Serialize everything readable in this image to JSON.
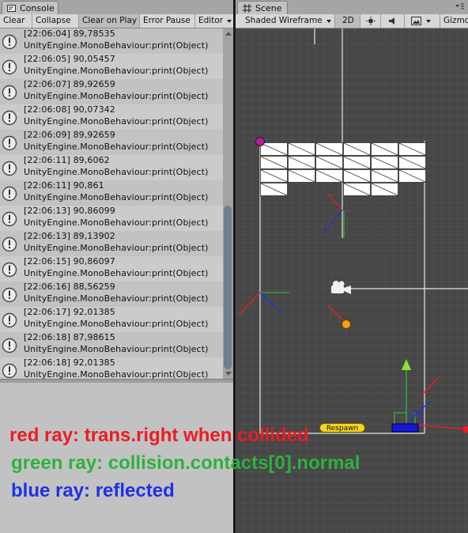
{
  "console": {
    "tab_label": "Console",
    "toolbar": [
      "Clear",
      "Collapse",
      "Clear on Play",
      "Error Pause",
      "Editor"
    ],
    "entries": [
      {
        "line1": "[22:06:04] 89,78535",
        "line2": "UnityEngine.MonoBehaviour:print(Object)"
      },
      {
        "line1": "[22:06:05] 90,05457",
        "line2": "UnityEngine.MonoBehaviour:print(Object)"
      },
      {
        "line1": "[22:06:07] 89,92659",
        "line2": "UnityEngine.MonoBehaviour:print(Object)"
      },
      {
        "line1": "[22:06:08] 90,07342",
        "line2": "UnityEngine.MonoBehaviour:print(Object)"
      },
      {
        "line1": "[22:06:09] 89,92659",
        "line2": "UnityEngine.MonoBehaviour:print(Object)"
      },
      {
        "line1": "[22:06:11] 89,6062",
        "line2": "UnityEngine.MonoBehaviour:print(Object)"
      },
      {
        "line1": "[22:06:11] 90,861",
        "line2": "UnityEngine.MonoBehaviour:print(Object)"
      },
      {
        "line1": "[22:06:13] 90,86099",
        "line2": "UnityEngine.MonoBehaviour:print(Object)"
      },
      {
        "line1": "[22:06:13] 89,13902",
        "line2": "UnityEngine.MonoBehaviour:print(Object)"
      },
      {
        "line1": "[22:06:15] 90,86097",
        "line2": "UnityEngine.MonoBehaviour:print(Object)"
      },
      {
        "line1": "[22:06:16] 88,56259",
        "line2": "UnityEngine.MonoBehaviour:print(Object)"
      },
      {
        "line1": "[22:06:17] 92,01385",
        "line2": "UnityEngine.MonoBehaviour:print(Object)"
      },
      {
        "line1": "[22:06:18] 87,98615",
        "line2": "UnityEngine.MonoBehaviour:print(Object)"
      },
      {
        "line1": "[22:06:18] 92,01385",
        "line2": "UnityEngine.MonoBehaviour:print(Object)"
      }
    ]
  },
  "scene": {
    "tab_label": "Scene",
    "draw_mode": "Shaded Wireframe",
    "mode_2d": "2D",
    "gizmos_label": "Gizmo",
    "respawn_label": "Respawn"
  },
  "captions": {
    "red": "red ray: trans.right when collided",
    "green": "green ray: collision.contacts[0].normal",
    "blue": "blue ray: reflected"
  },
  "colors": {
    "red_ray": "#ec1c24",
    "green_ray": "#2eb13e",
    "blue_ray": "#1d31e6",
    "scene_bg": "#474747",
    "scroll_thumb": "#6e7f92"
  },
  "icons": [
    "console-icon",
    "warning-icon",
    "scene-icon",
    "dropdown-arrow-icon",
    "light-icon",
    "speaker-icon",
    "image-icon",
    "camera-icon",
    "ball-icon"
  ]
}
